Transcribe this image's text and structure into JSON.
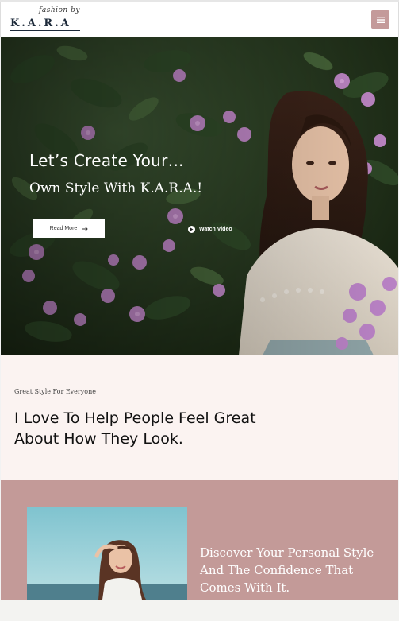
{
  "header": {
    "logo_script": "fashion by",
    "logo_word": "K.A.R.A",
    "menu_icon": "hamburger-icon",
    "accent_color": "#c49a9a"
  },
  "hero": {
    "title": "Let’s Create Your…",
    "subtitle": "Own Style With K.A.R.A.!",
    "read_more_label": "Read More",
    "watch_video_label": "Watch Video",
    "image": "woman-with-purple-flowers"
  },
  "intro": {
    "eyebrow": "Great Style For Everyone",
    "headline": "I Love To Help People Feel Great About How They Look.",
    "background_color": "#fbf3f1"
  },
  "feature": {
    "text": "Discover Your Personal Style And The Confidence That Comes With It.",
    "image": "smiling-woman-by-sea",
    "background_color": "#c39a98"
  }
}
